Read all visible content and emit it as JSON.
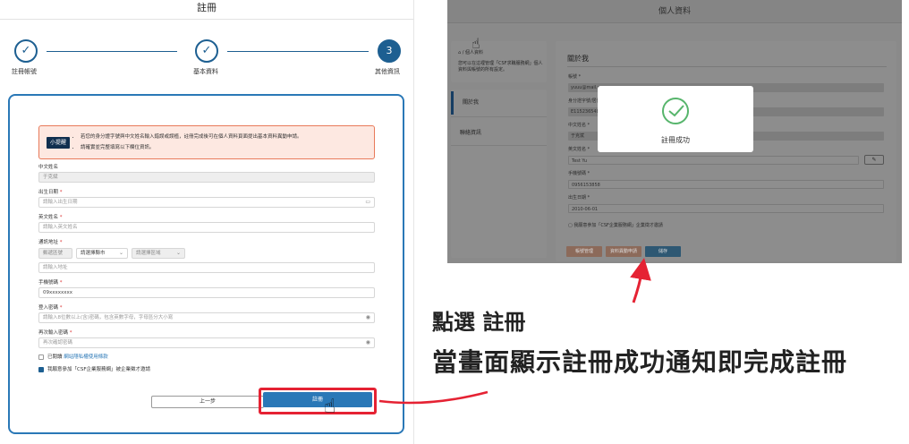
{
  "register": {
    "title": "註冊",
    "steps": [
      {
        "label": "註冊帳號",
        "state": "done"
      },
      {
        "label": "基本資料",
        "state": "done"
      },
      {
        "label": "其他資訊",
        "state": "active",
        "number": "3"
      }
    ],
    "notice": {
      "tag": "小提醒",
      "lines": [
        "若您的身分證字號與中文姓名輸入錯誤或誤植，註冊完成後可在個人資料頁面提出基本資料異動申請。",
        "請確實並完整填寫以下欄位資訊。"
      ]
    },
    "fields": {
      "chinese_name": {
        "label": "中文姓名",
        "value": "于克斌"
      },
      "birthday": {
        "label": "出生日期",
        "placeholder": "請輸入出生日期"
      },
      "english_name": {
        "label": "英文姓名",
        "placeholder": "請輸入英文姓名"
      },
      "address": {
        "label": "通訊地址",
        "postcode_placeholder": "郵遞區號",
        "city_placeholder": "請選擇縣市",
        "district_placeholder": "請選擇區域",
        "street_placeholder": "請輸入地址"
      },
      "mobile": {
        "label": "手機號碼",
        "value": "09xxxxxxxx"
      },
      "password": {
        "label": "登入密碼",
        "placeholder": "請輸入8位數以上(含)密碼，包含英數字母，字母區分大小寫"
      },
      "password_confirm": {
        "label": "再次輸入密碼",
        "placeholder": "再次確認密碼"
      }
    },
    "agree": {
      "prefix": "已閱讀",
      "link": "網站隱私權使用條款"
    },
    "join": "我願意參加「CSF企業服務網」被企業徵才邀請",
    "prev_button": "上一步",
    "register_button": "註冊"
  },
  "profile": {
    "header": "個人資料",
    "breadcrumb": "/ 個人資料",
    "description": "您可以在這裡管理「CSF求職服務網」個人資料與帳號的所有設定。",
    "menu": [
      "關於我",
      "聯絡資訊"
    ],
    "section_title": "關於我",
    "fields": [
      {
        "label": "帳號",
        "value": "yuuu@mail.c"
      },
      {
        "label": "身分證字號/居留證號",
        "value": "E115236548"
      },
      {
        "label": "中文姓名",
        "value": "于克斌"
      },
      {
        "label": "英文姓名",
        "value": "Test Yu"
      },
      {
        "label": "手機號碼",
        "value": "0956153858"
      },
      {
        "label": "出生日期",
        "value": "2010-06-01"
      }
    ],
    "join": "我願意參加「CSF企業服務網」企業徵才邀請",
    "buttons": [
      "帳號管理",
      "資料異動申請",
      "儲存"
    ],
    "modal": {
      "message": "註冊成功"
    }
  },
  "instructions": {
    "line1": "點選 註冊",
    "line2": "當畫面顯示註冊成功通知即完成註冊"
  },
  "colors": {
    "primary": "#2a78b7",
    "step_dark": "#1d5f91",
    "highlight": "#e52233",
    "notice_bg": "#fde8e1",
    "success": "#57b56c"
  }
}
